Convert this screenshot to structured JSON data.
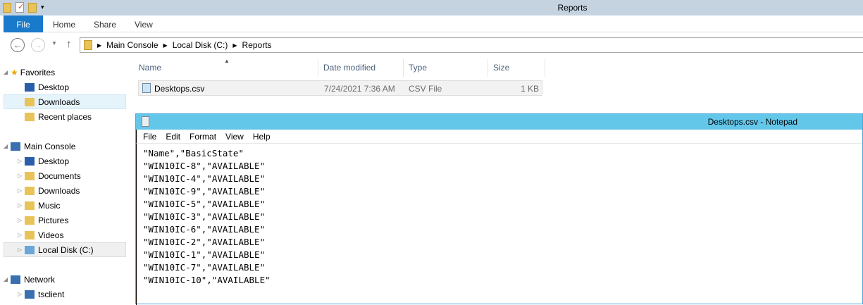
{
  "window": {
    "title": "Reports"
  },
  "ribbon": {
    "tabs": [
      "File",
      "Home",
      "Share",
      "View"
    ]
  },
  "address": {
    "path": [
      "Main Console",
      "Local Disk (C:)",
      "Reports"
    ]
  },
  "sidebar": {
    "favorites": {
      "label": "Favorites",
      "items": [
        "Desktop",
        "Downloads",
        "Recent places"
      ]
    },
    "computer": {
      "label": "Main Console",
      "items": [
        "Desktop",
        "Documents",
        "Downloads",
        "Music",
        "Pictures",
        "Videos",
        "Local Disk (C:)"
      ]
    },
    "network": {
      "label": "Network",
      "items": [
        "tsclient"
      ]
    }
  },
  "list": {
    "columns": [
      "Name",
      "Date modified",
      "Type",
      "Size"
    ],
    "rows": [
      {
        "name": "Desktops.csv",
        "date": "7/24/2021 7:36 AM",
        "type": "CSV File",
        "size": "1 KB"
      }
    ]
  },
  "notepad": {
    "title": "Desktops.csv - Notepad",
    "menu": [
      "File",
      "Edit",
      "Format",
      "View",
      "Help"
    ],
    "lines": [
      "\"Name\",\"BasicState\"",
      "\"WIN10IC-8\",\"AVAILABLE\"",
      "\"WIN10IC-4\",\"AVAILABLE\"",
      "\"WIN10IC-9\",\"AVAILABLE\"",
      "\"WIN10IC-5\",\"AVAILABLE\"",
      "\"WIN10IC-3\",\"AVAILABLE\"",
      "\"WIN10IC-6\",\"AVAILABLE\"",
      "\"WIN10IC-2\",\"AVAILABLE\"",
      "\"WIN10IC-1\",\"AVAILABLE\"",
      "\"WIN10IC-7\",\"AVAILABLE\"",
      "\"WIN10IC-10\",\"AVAILABLE\""
    ]
  }
}
